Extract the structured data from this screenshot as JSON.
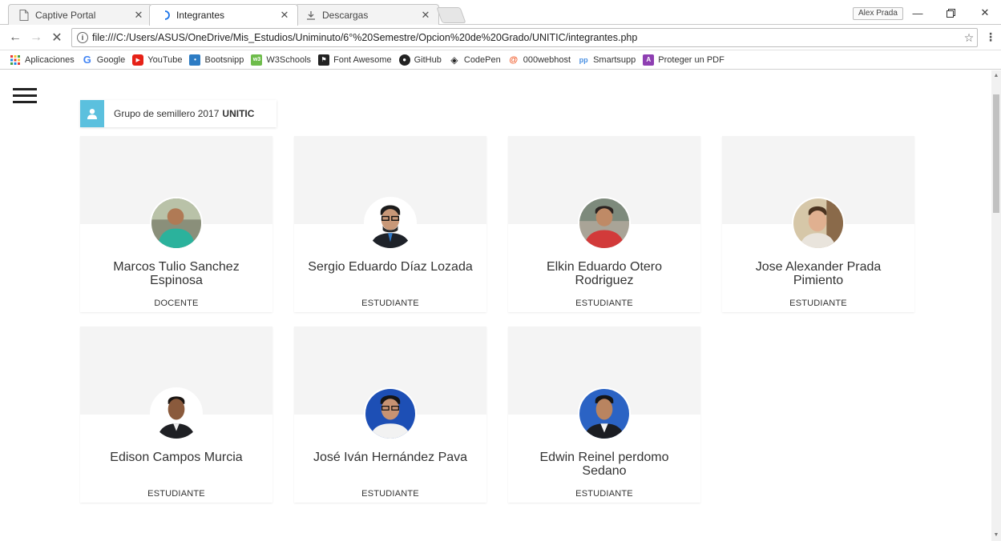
{
  "browser": {
    "tabs": [
      {
        "title": "Captive Portal",
        "active": false,
        "icon": "page-icon"
      },
      {
        "title": "Integrantes",
        "active": true,
        "icon": "loading-icon"
      },
      {
        "title": "Descargas",
        "active": false,
        "icon": "download-icon"
      }
    ],
    "profile_name": "Alex Prada",
    "url": "file:///C:/Users/ASUS/OneDrive/Mis_Estudios/Uniminuto/6°%20Semestre/Opcion%20de%20Grado/UNITIC/integrantes.php",
    "bookmarks": [
      {
        "label": "Aplicaciones",
        "icon": "apps-grid-icon",
        "color": "#e53935"
      },
      {
        "label": "Google",
        "icon": "google-icon",
        "color": "#4285f4"
      },
      {
        "label": "YouTube",
        "icon": "youtube-icon",
        "color": "#e62117"
      },
      {
        "label": "Bootsnipp",
        "icon": "bootsnipp-icon",
        "color": "#2d7cc4"
      },
      {
        "label": "W3Schools",
        "icon": "w3schools-icon",
        "color": "#6ebc4b"
      },
      {
        "label": "Font Awesome",
        "icon": "font-awesome-icon",
        "color": "#222222"
      },
      {
        "label": "GitHub",
        "icon": "github-icon",
        "color": "#222222"
      },
      {
        "label": "CodePen",
        "icon": "codepen-icon",
        "color": "#222222"
      },
      {
        "label": "000webhost",
        "icon": "webhost-icon",
        "color": "#f05a28"
      },
      {
        "label": "Smartsupp",
        "icon": "smartsupp-icon",
        "color": "#4a90e2"
      },
      {
        "label": "Proteger un PDF",
        "icon": "pdf-icon",
        "color": "#8e3fb2"
      }
    ]
  },
  "page": {
    "group_label": "Grupo de semillero 2017",
    "group_name": "UNITIC",
    "accent_color": "#5bc0de",
    "members": [
      {
        "name": "Marcos Tulio Sanchez Espinosa",
        "role": "DOCENTE"
      },
      {
        "name": "Sergio Eduardo Díaz Lozada",
        "role": "ESTUDIANTE"
      },
      {
        "name": "Elkin Eduardo Otero Rodriguez",
        "role": "ESTUDIANTE"
      },
      {
        "name": "Jose Alexander Prada Pimiento",
        "role": "ESTUDIANTE"
      },
      {
        "name": "Edison Campos Murcia",
        "role": "ESTUDIANTE"
      },
      {
        "name": "José Iván Hernández Pava",
        "role": "ESTUDIANTE"
      },
      {
        "name": "Edwin Reinel perdomo Sedano",
        "role": "ESTUDIANTE"
      }
    ]
  }
}
